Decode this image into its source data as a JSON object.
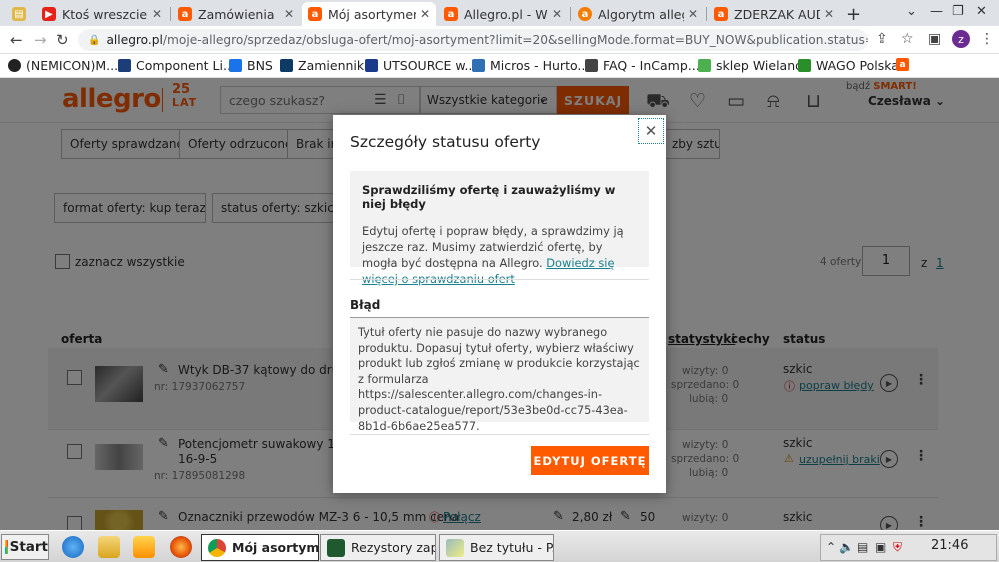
{
  "browser": {
    "tabs": [
      {
        "title": "Ktoś wreszcie mu",
        "fav_color": "#d13d3d"
      },
      {
        "title": "Zamówienia",
        "fav_color": "#ff5a00"
      },
      {
        "title": "Mój asortyment",
        "fav_color": "#ff5a00"
      },
      {
        "title": "Allegro.pl - Więc",
        "fav_color": "#ff5a00"
      },
      {
        "title": "Algorytm allegro",
        "fav_color": "#ff5a00"
      },
      {
        "title": "ZDERZAK AUDI C",
        "fav_color": "#ff5a00"
      }
    ],
    "url_host": "allegro.pl",
    "url_path": "/moje-allegro/sprzedaz/obsluga-ofert/moj-asortyment?limit=20&sellingMode.format=BUY_NOW&publication.status=INACTIVE",
    "profile_letter": "z",
    "bookmarks": [
      {
        "label": "(NEMICON)M...",
        "color": "#222"
      },
      {
        "label": "Component Li...",
        "color": "#1c3d7a"
      },
      {
        "label": "BNS",
        "color": "#1a73e8"
      },
      {
        "label": "Zamienniki",
        "color": "#0d3b66"
      },
      {
        "label": "UTSOURCE w...",
        "color": "#1b3a8c"
      },
      {
        "label": "Micros - Hurto...",
        "color": "#2f6fb3"
      },
      {
        "label": "FAQ - InCamp...",
        "color": "#444"
      },
      {
        "label": "sklep Wieland",
        "color": "#4caf50"
      },
      {
        "label": "WAGO Polska",
        "color": "#2a8f2a"
      }
    ]
  },
  "header": {
    "logo": "allegro",
    "logo_badge_num": "25",
    "logo_badge_word": "LAT",
    "search_placeholder": "czego szukasz?",
    "category": "Wszystkie kategorie",
    "search_button": "SZUKAJ",
    "smart_prefix": "bądź",
    "smart_brand": "SMART!",
    "user": "Czesława"
  },
  "filters": {
    "chips": [
      "Oferty sprawdzane",
      "Oferty odrzucone",
      "Brak inf"
    ],
    "chip_right": "zby sztuk",
    "active": [
      "format oferty: kup teraz",
      "status oferty: szkic"
    ],
    "select_all": "zaznacz wszystkie",
    "offer_count": "4 oferty",
    "page_current": "1",
    "page_of": "z",
    "page_total": "1"
  },
  "table": {
    "headers": {
      "offer": "oferta",
      "stats": "statystyki",
      "features": "cechy",
      "status": "status"
    },
    "stat_labels": {
      "views": "wizyty:",
      "sold": "sprzedano:",
      "likes": "lubią:"
    },
    "rows": [
      {
        "title": "Wtyk DB-37 kątowy do druku 29",
        "title2": "",
        "nr": "nr: 17937062757",
        "views": "0",
        "sold": "0",
        "likes": "0",
        "status": "szkic",
        "action": "popraw błędy",
        "price": "",
        "qty": "",
        "issue": ""
      },
      {
        "title": "Potencjometr suwakowy 1 kOhm",
        "title2": "16-9-5",
        "nr": "nr: 17895081298",
        "views": "0",
        "sold": "0",
        "likes": "0",
        "status": "szkic",
        "action": "uzupełnij braki",
        "price": "",
        "qty": "",
        "issue": ""
      },
      {
        "title": "Oznaczniki przewodów MZ-3 6 - 10,5 mm cena",
        "title2": "",
        "nr": "",
        "views": "0",
        "sold": "",
        "likes": "",
        "status": "szkic",
        "action": "",
        "price": "2,80 zł",
        "qty": "50",
        "issue": "Połącz"
      }
    ]
  },
  "modal": {
    "title": "Szczegóły statusu oferty",
    "info_heading": "Sprawdziliśmy ofertę i zauważyliśmy w niej błędy",
    "info_text": "Edytuj ofertę i popraw błędy, a sprawdzimy ją jeszcze raz. Musimy zatwierdzić ofertę, by mogła być dostępna na Allegro. ",
    "info_link": "Dowiedz się więcej o sprawdzaniu ofert",
    "error_label": "Błąd",
    "error_text": "Tytuł oferty nie pasuje do nazwy wybranego produktu. Dopasuj tytuł oferty, wybierz właściwy produkt lub zgłoś zmianę w produkcie korzystając z formularza https://salescenter.allegro.com/changes-in-product-catalogue/report/53e3be0d-cc75-43ea-8b1d-6b6ae25ea577.",
    "edit_button": "EDYTUJ OFERTĘ"
  },
  "taskbar": {
    "start": "Start",
    "tasks": [
      {
        "label": "Mój asortym...",
        "color": "#db4437"
      },
      {
        "label": "Rezystory zap...",
        "color": "#1e5a2e"
      },
      {
        "label": "Bez tytułu - P...",
        "color": "#9bb"
      }
    ],
    "time": "21:46"
  }
}
